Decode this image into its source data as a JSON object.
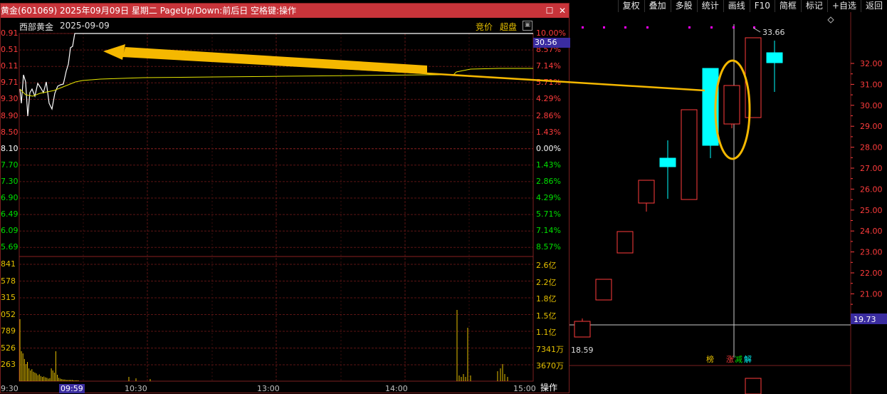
{
  "toolbar": {
    "items": [
      "复权",
      "叠加",
      "多股",
      "统计",
      "画线",
      "F10",
      "简框",
      "标记",
      "+自选",
      "返回"
    ]
  },
  "popup": {
    "title": "黄金(601069) 2025年09月09日 星期二 PageUp/Down:前后日 空格键:操作",
    "stock_name": "西部黄金",
    "date": "2025-09-09",
    "tag_auction": "竞价",
    "tag_superorder": "超盘",
    "current_price_tag": "30.56",
    "left_price_labels": [
      "0.91",
      "0.51",
      "0.11",
      "9.71",
      "9.30",
      "8.90",
      "8.50",
      "8.10",
      "7.70",
      "7.30",
      "6.90",
      "6.49",
      "6.09",
      "5.69"
    ],
    "right_pct_labels": [
      "10.00%",
      "8.57%",
      "7.14%",
      "5.71%",
      "4.29%",
      "2.86%",
      "1.43%",
      "0.00%",
      "1.43%",
      "2.86%",
      "4.29%",
      "5.71%",
      "7.14%",
      "8.57%"
    ],
    "left_vol_labels": [
      "841",
      "578",
      "315",
      "052",
      "789",
      "526",
      "263"
    ],
    "right_vol_labels": [
      "2.6亿",
      "2.2亿",
      "1.8亿",
      "1.5亿",
      "1.1亿",
      "7341万",
      "3670万"
    ],
    "time_labels": [
      "9:30",
      "09:59",
      "10:30",
      "13:00",
      "14:00",
      "15:00"
    ],
    "operate_label": "操作",
    "colors": {
      "up": "#ff3c3c",
      "down": "#00e000",
      "neutral": "#ffffff",
      "title_bg": "#c8343a",
      "avg_line": "#e6e600",
      "price_line": "#ffffff",
      "arrow": "#f5b800"
    }
  },
  "kline": {
    "price_axis": [
      "32.00",
      "31.00",
      "30.00",
      "29.00",
      "28.00",
      "27.00",
      "26.00",
      "25.00",
      "24.00",
      "23.00",
      "22.00",
      "21.00"
    ],
    "current_price_tag": "19.73",
    "high_label": "33.66",
    "low_label": "18.59",
    "bottom_tags": [
      "榜",
      "涨",
      "减",
      "解"
    ],
    "colors": {
      "up": "#ff3c3c",
      "down": "#00ffff",
      "current_tag_bg": "#3a2ca0",
      "circle": "#f5b800"
    }
  }
}
